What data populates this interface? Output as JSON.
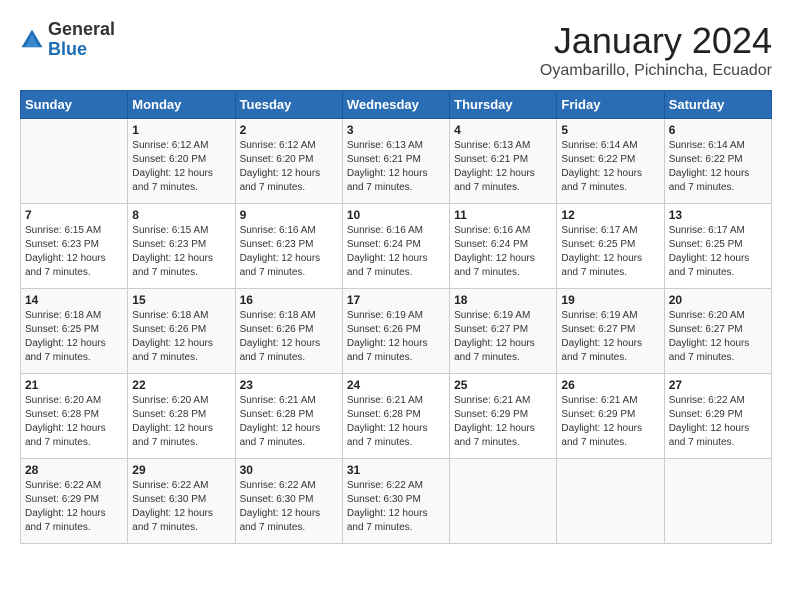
{
  "header": {
    "logo": {
      "general": "General",
      "blue": "Blue"
    },
    "title": "January 2024",
    "subtitle": "Oyambarillo, Pichincha, Ecuador"
  },
  "days_of_week": [
    "Sunday",
    "Monday",
    "Tuesday",
    "Wednesday",
    "Thursday",
    "Friday",
    "Saturday"
  ],
  "weeks": [
    [
      {
        "day": "",
        "sunrise": "",
        "sunset": "",
        "daylight": ""
      },
      {
        "day": "1",
        "sunrise": "Sunrise: 6:12 AM",
        "sunset": "Sunset: 6:20 PM",
        "daylight": "Daylight: 12 hours and 7 minutes."
      },
      {
        "day": "2",
        "sunrise": "Sunrise: 6:12 AM",
        "sunset": "Sunset: 6:20 PM",
        "daylight": "Daylight: 12 hours and 7 minutes."
      },
      {
        "day": "3",
        "sunrise": "Sunrise: 6:13 AM",
        "sunset": "Sunset: 6:21 PM",
        "daylight": "Daylight: 12 hours and 7 minutes."
      },
      {
        "day": "4",
        "sunrise": "Sunrise: 6:13 AM",
        "sunset": "Sunset: 6:21 PM",
        "daylight": "Daylight: 12 hours and 7 minutes."
      },
      {
        "day": "5",
        "sunrise": "Sunrise: 6:14 AM",
        "sunset": "Sunset: 6:22 PM",
        "daylight": "Daylight: 12 hours and 7 minutes."
      },
      {
        "day": "6",
        "sunrise": "Sunrise: 6:14 AM",
        "sunset": "Sunset: 6:22 PM",
        "daylight": "Daylight: 12 hours and 7 minutes."
      }
    ],
    [
      {
        "day": "7",
        "sunrise": "Sunrise: 6:15 AM",
        "sunset": "Sunset: 6:23 PM",
        "daylight": "Daylight: 12 hours and 7 minutes."
      },
      {
        "day": "8",
        "sunrise": "Sunrise: 6:15 AM",
        "sunset": "Sunset: 6:23 PM",
        "daylight": "Daylight: 12 hours and 7 minutes."
      },
      {
        "day": "9",
        "sunrise": "Sunrise: 6:16 AM",
        "sunset": "Sunset: 6:23 PM",
        "daylight": "Daylight: 12 hours and 7 minutes."
      },
      {
        "day": "10",
        "sunrise": "Sunrise: 6:16 AM",
        "sunset": "Sunset: 6:24 PM",
        "daylight": "Daylight: 12 hours and 7 minutes."
      },
      {
        "day": "11",
        "sunrise": "Sunrise: 6:16 AM",
        "sunset": "Sunset: 6:24 PM",
        "daylight": "Daylight: 12 hours and 7 minutes."
      },
      {
        "day": "12",
        "sunrise": "Sunrise: 6:17 AM",
        "sunset": "Sunset: 6:25 PM",
        "daylight": "Daylight: 12 hours and 7 minutes."
      },
      {
        "day": "13",
        "sunrise": "Sunrise: 6:17 AM",
        "sunset": "Sunset: 6:25 PM",
        "daylight": "Daylight: 12 hours and 7 minutes."
      }
    ],
    [
      {
        "day": "14",
        "sunrise": "Sunrise: 6:18 AM",
        "sunset": "Sunset: 6:25 PM",
        "daylight": "Daylight: 12 hours and 7 minutes."
      },
      {
        "day": "15",
        "sunrise": "Sunrise: 6:18 AM",
        "sunset": "Sunset: 6:26 PM",
        "daylight": "Daylight: 12 hours and 7 minutes."
      },
      {
        "day": "16",
        "sunrise": "Sunrise: 6:18 AM",
        "sunset": "Sunset: 6:26 PM",
        "daylight": "Daylight: 12 hours and 7 minutes."
      },
      {
        "day": "17",
        "sunrise": "Sunrise: 6:19 AM",
        "sunset": "Sunset: 6:26 PM",
        "daylight": "Daylight: 12 hours and 7 minutes."
      },
      {
        "day": "18",
        "sunrise": "Sunrise: 6:19 AM",
        "sunset": "Sunset: 6:27 PM",
        "daylight": "Daylight: 12 hours and 7 minutes."
      },
      {
        "day": "19",
        "sunrise": "Sunrise: 6:19 AM",
        "sunset": "Sunset: 6:27 PM",
        "daylight": "Daylight: 12 hours and 7 minutes."
      },
      {
        "day": "20",
        "sunrise": "Sunrise: 6:20 AM",
        "sunset": "Sunset: 6:27 PM",
        "daylight": "Daylight: 12 hours and 7 minutes."
      }
    ],
    [
      {
        "day": "21",
        "sunrise": "Sunrise: 6:20 AM",
        "sunset": "Sunset: 6:28 PM",
        "daylight": "Daylight: 12 hours and 7 minutes."
      },
      {
        "day": "22",
        "sunrise": "Sunrise: 6:20 AM",
        "sunset": "Sunset: 6:28 PM",
        "daylight": "Daylight: 12 hours and 7 minutes."
      },
      {
        "day": "23",
        "sunrise": "Sunrise: 6:21 AM",
        "sunset": "Sunset: 6:28 PM",
        "daylight": "Daylight: 12 hours and 7 minutes."
      },
      {
        "day": "24",
        "sunrise": "Sunrise: 6:21 AM",
        "sunset": "Sunset: 6:28 PM",
        "daylight": "Daylight: 12 hours and 7 minutes."
      },
      {
        "day": "25",
        "sunrise": "Sunrise: 6:21 AM",
        "sunset": "Sunset: 6:29 PM",
        "daylight": "Daylight: 12 hours and 7 minutes."
      },
      {
        "day": "26",
        "sunrise": "Sunrise: 6:21 AM",
        "sunset": "Sunset: 6:29 PM",
        "daylight": "Daylight: 12 hours and 7 minutes."
      },
      {
        "day": "27",
        "sunrise": "Sunrise: 6:22 AM",
        "sunset": "Sunset: 6:29 PM",
        "daylight": "Daylight: 12 hours and 7 minutes."
      }
    ],
    [
      {
        "day": "28",
        "sunrise": "Sunrise: 6:22 AM",
        "sunset": "Sunset: 6:29 PM",
        "daylight": "Daylight: 12 hours and 7 minutes."
      },
      {
        "day": "29",
        "sunrise": "Sunrise: 6:22 AM",
        "sunset": "Sunset: 6:30 PM",
        "daylight": "Daylight: 12 hours and 7 minutes."
      },
      {
        "day": "30",
        "sunrise": "Sunrise: 6:22 AM",
        "sunset": "Sunset: 6:30 PM",
        "daylight": "Daylight: 12 hours and 7 minutes."
      },
      {
        "day": "31",
        "sunrise": "Sunrise: 6:22 AM",
        "sunset": "Sunset: 6:30 PM",
        "daylight": "Daylight: 12 hours and 7 minutes."
      },
      {
        "day": "",
        "sunrise": "",
        "sunset": "",
        "daylight": ""
      },
      {
        "day": "",
        "sunrise": "",
        "sunset": "",
        "daylight": ""
      },
      {
        "day": "",
        "sunrise": "",
        "sunset": "",
        "daylight": ""
      }
    ]
  ]
}
